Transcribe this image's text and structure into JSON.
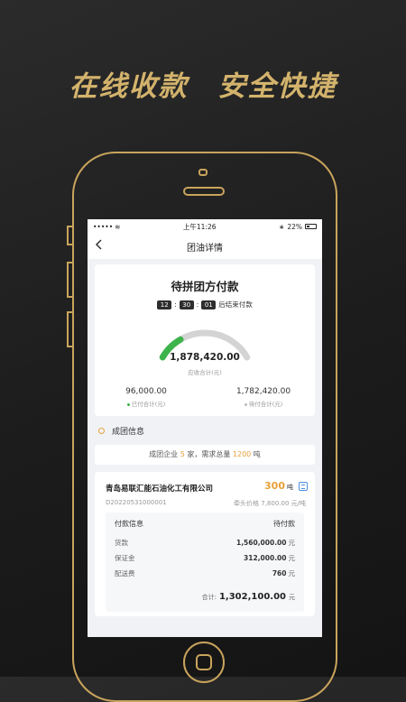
{
  "tagline": {
    "left": "在线收款",
    "right": "安全快捷"
  },
  "statusbar": {
    "signal": "•••••",
    "wifi": "≋",
    "time": "上午11:26",
    "bluetooth": "∗",
    "battery": "22%"
  },
  "nav": {
    "back_icon": "chevron-left-icon",
    "title": "团油详情"
  },
  "payment": {
    "title": "待拼团方付款",
    "countdown": {
      "hours": "12",
      "minutes": "30",
      "seconds": "01",
      "sep": ":",
      "suffix": "后结束付款"
    },
    "amount": "1,878,420.00",
    "amount_label": "应收合计(元)",
    "paid_value": "96,000.00",
    "paid_label": "已付合计(元)",
    "pending_value": "1,782,420.00",
    "pending_label": "待付合计(元)",
    "progress_paid_fraction": 0.051,
    "colors": {
      "paid": "#3cb44b",
      "pending": "#cfcfcf",
      "accent": "#e8a13a"
    }
  },
  "group": {
    "section_title": "成团信息",
    "summary": {
      "prefix": "成团企业 ",
      "companies": "5",
      "mid": " 家，需求总量 ",
      "total": "1200",
      "suffix": " 吨"
    }
  },
  "company": {
    "name": "青岛易联汇能石油化工有限公司",
    "quantity": "300",
    "quantity_unit": "吨",
    "doc_icon": "document-icon",
    "id": "D20220531000001",
    "price": "牵头价格 7,800.00 元/吨",
    "pay_info_label": "付款信息",
    "pay_status": "待付款",
    "rows": [
      {
        "label": "货款",
        "value": "1,560,000.00",
        "unit": "元"
      },
      {
        "label": "保证金",
        "value": "312,000.00",
        "unit": "元"
      },
      {
        "label": "配送费",
        "value": "760",
        "unit": "元"
      }
    ],
    "total_label": "合计:",
    "total_value": "1,302,100.00",
    "total_unit": "元"
  }
}
